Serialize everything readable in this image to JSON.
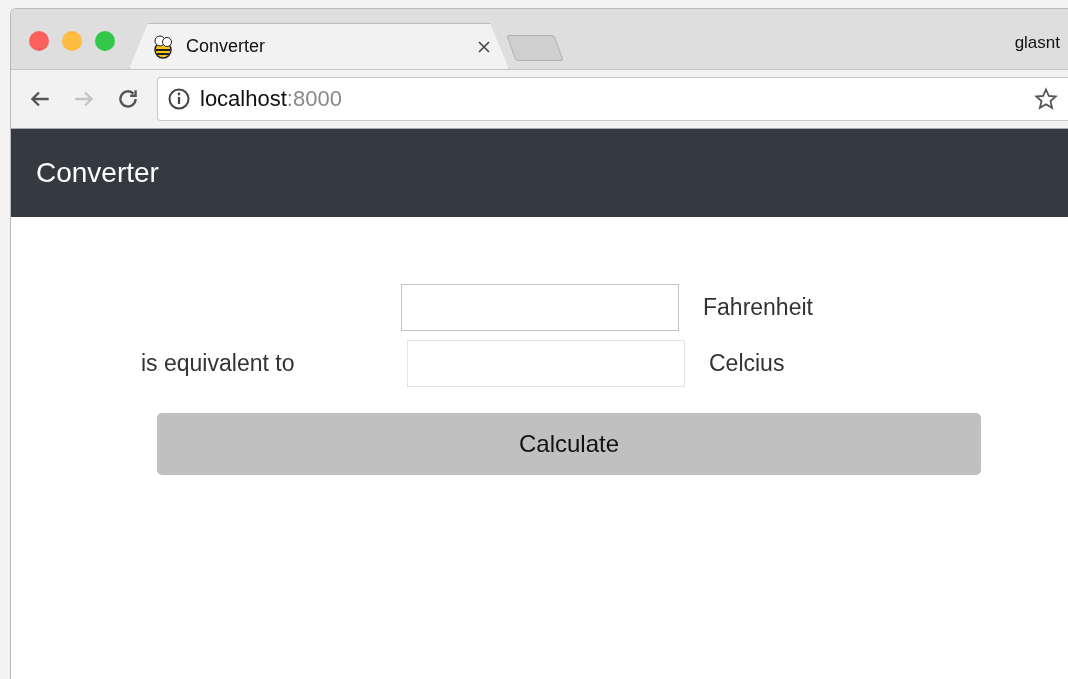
{
  "browser": {
    "tabs": [
      {
        "title": "Converter",
        "selected": true
      }
    ],
    "profile": "glasnt",
    "nav": [
      {
        "kind": "back",
        "disabled": false
      },
      {
        "kind": "forward",
        "disabled": true
      },
      {
        "kind": "reload",
        "disabled": false
      }
    ],
    "address": {
      "host": "localhost",
      "port": ":8000"
    }
  },
  "navbar": {
    "brand": "Converter"
  },
  "form": {
    "rows": [
      {
        "label_before": "",
        "value": "",
        "readonly": false,
        "label_after": "Fahrenheit"
      },
      {
        "label_before": "is equivalent to",
        "value": "",
        "readonly": true,
        "label_after": "Celcius"
      }
    ],
    "button": "Calculate"
  }
}
